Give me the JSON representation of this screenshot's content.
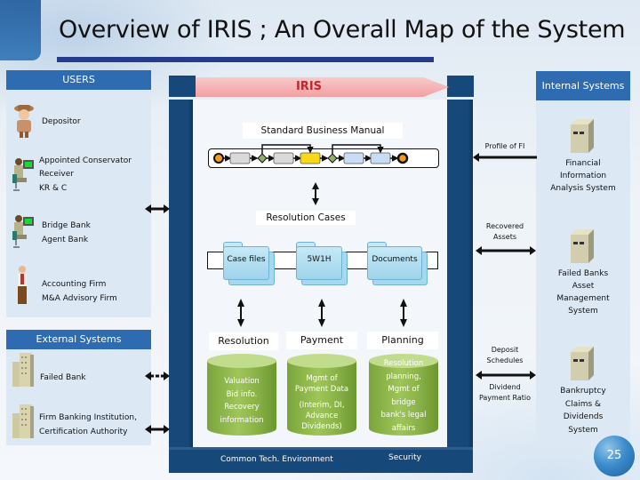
{
  "title": "Overview of IRIS ; An Overall Map of the System",
  "users_panel": {
    "header": "USERS",
    "items": [
      {
        "icon": "elderly-person-icon",
        "lines": [
          "Depositor"
        ]
      },
      {
        "icon": "computer-worker-icon",
        "lines": [
          "Appointed  Conservator",
          "Receiver",
          "KR & C"
        ]
      },
      {
        "icon": "computer-worker-icon",
        "lines": [
          "Bridge Bank",
          "Agent Bank"
        ]
      },
      {
        "icon": "businessman-icon",
        "lines": [
          "Accounting Firm",
          "M&A Advisory Firm"
        ]
      }
    ]
  },
  "external_panel": {
    "header": "External Systems",
    "items": [
      {
        "icon": "building-icon",
        "lines": [
          "Failed Bank"
        ]
      },
      {
        "icon": "building-icon",
        "lines": [
          "Firm Banking Institution,",
          "Certification Authority"
        ]
      }
    ]
  },
  "internal_panel": {
    "header": "Internal Systems",
    "items": [
      {
        "icon": "server-icon",
        "lines": [
          "Financial",
          "Information",
          "Analysis System"
        ]
      },
      {
        "icon": "server-icon",
        "lines": [
          "Failed Banks",
          "Asset",
          "Management",
          "System"
        ]
      },
      {
        "icon": "server-icon",
        "lines": [
          "Bankruptcy",
          "Claims &",
          "Dividends",
          "System"
        ]
      }
    ]
  },
  "iris": {
    "label": "IRIS",
    "standard_business_manual": "Standard Business Manual",
    "resolution_cases": "Resolution Cases",
    "folders": [
      "Case files",
      "5W1H",
      "Documents"
    ],
    "modules": [
      {
        "name": "Resolution",
        "lines": [
          "Valuation",
          "Bid info.",
          "Recovery",
          "information"
        ]
      },
      {
        "name": "Payment",
        "lines": [
          "Mgmt of",
          "Payment Data",
          "(Interim, DI,",
          "Advance",
          "Dividends)"
        ]
      },
      {
        "name": "Planning",
        "lines": [
          "Resolution",
          "planning,",
          "Mgmt of",
          "bridge",
          "bank's legal",
          "affairs"
        ]
      }
    ],
    "bottom_left": "Common Tech. Environment",
    "bottom_right": "Security"
  },
  "flows": {
    "profile_of_fi": "Profile of FI",
    "recovered_assets": [
      "Recovered",
      "Assets"
    ],
    "deposit_schedules": [
      "Deposit",
      "Schedules"
    ],
    "dividend_payment_ratio": [
      "Dividend",
      "Payment Ratio"
    ]
  },
  "page_number": "25",
  "colors": {
    "panel_header": "#2f6bb0",
    "panel_bg": "#dde8f5",
    "frame": "#17487a",
    "iris_bar": "#f4a9ab",
    "cylinder": "#8db84a",
    "folder": "#b7e0f2",
    "title_rule": "#253b8c"
  }
}
